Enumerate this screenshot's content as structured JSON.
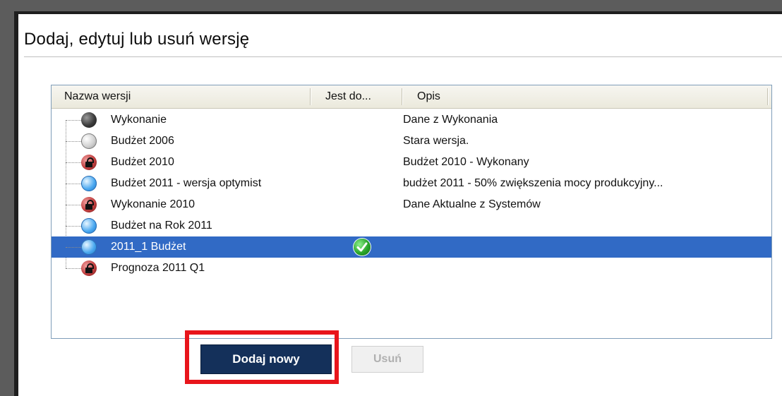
{
  "title": "Dodaj, edytuj lub usuń wersję",
  "grid": {
    "columns": [
      "Nazwa wersji",
      "Jest do...",
      "Opis"
    ],
    "rows": [
      {
        "name": "Wykonanie",
        "icon": "dark-ball-icon",
        "description": "Dane z Wykonania",
        "is_default": false,
        "selected": false
      },
      {
        "name": "Budżet 2006",
        "icon": "gray-ball-icon",
        "description": "Stara wersja.",
        "is_default": false,
        "selected": false
      },
      {
        "name": "Budżet 2010",
        "icon": "locked-version-icon",
        "description": "Budżet 2010 - Wykonany",
        "is_default": false,
        "selected": false
      },
      {
        "name": "Budżet 2011 - wersja optymist",
        "icon": "blue-ball-icon",
        "description": "budżet 2011 - 50% zwiększenia mocy produkcyjny...",
        "is_default": false,
        "selected": false
      },
      {
        "name": "Wykonanie 2010",
        "icon": "locked-version-icon",
        "description": "Dane Aktualne z Systemów",
        "is_default": false,
        "selected": false
      },
      {
        "name": "Budżet na Rok 2011",
        "icon": "blue-ball-icon",
        "description": "",
        "is_default": false,
        "selected": false
      },
      {
        "name": "2011_1 Budżet",
        "icon": "blue-ball-icon",
        "description": "",
        "is_default": true,
        "selected": true
      },
      {
        "name": "Prognoza 2011 Q1",
        "icon": "locked-version-icon",
        "description": "",
        "is_default": false,
        "selected": false
      }
    ]
  },
  "buttons": {
    "add_label": "Dodaj nowy",
    "remove_label": "Usuń"
  },
  "colors": {
    "selection": "#316ac5",
    "add_button": "#14305a",
    "highlight": "#e8151b"
  }
}
